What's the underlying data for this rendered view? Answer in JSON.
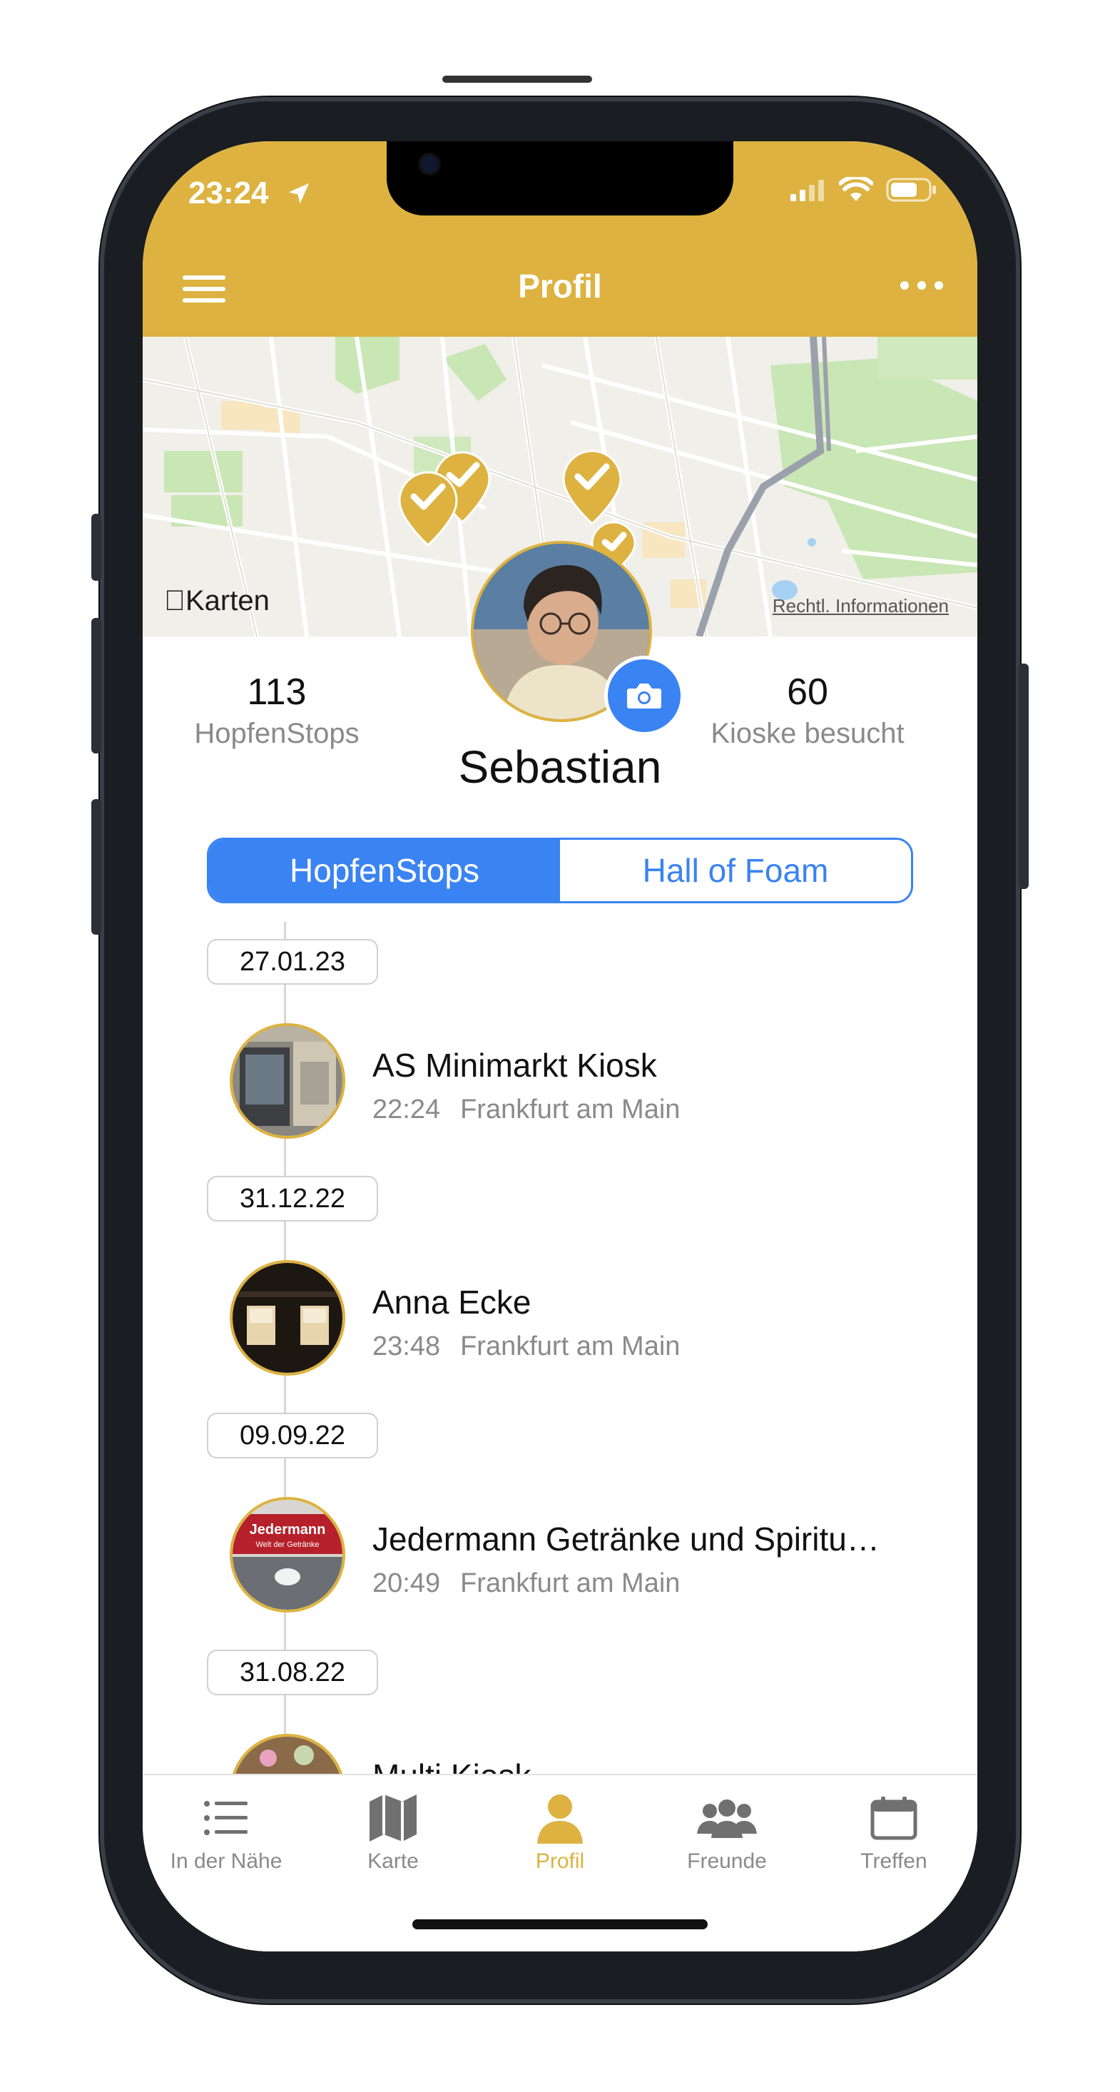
{
  "status_bar": {
    "time": "23:24"
  },
  "header": {
    "title": "Profil"
  },
  "map": {
    "logo_text": "Karten",
    "legal_link": "Rechtl. Informationen"
  },
  "profile": {
    "name": "Sebastian",
    "stats": [
      {
        "value": "113",
        "label": "HopfenStops"
      },
      {
        "value": "60",
        "label": "Kioske besucht"
      }
    ]
  },
  "segmented": {
    "options": [
      "HopfenStops",
      "Hall of Foam"
    ],
    "selected": "HopfenStops"
  },
  "timeline": [
    {
      "date": "27.01.23",
      "name": "AS Minimarkt Kiosk",
      "time": "22:24",
      "city": "Frankfurt am Main"
    },
    {
      "date": "31.12.22",
      "name": "Anna Ecke",
      "time": "23:48",
      "city": "Frankfurt am Main"
    },
    {
      "date": "09.09.22",
      "name": "Jedermann Getränke und Spiritu…",
      "time": "20:49",
      "city": "Frankfurt am Main"
    },
    {
      "date": "31.08.22",
      "name": "Multi Kiosk",
      "time": "",
      "city": ""
    }
  ],
  "thumb_texts": {
    "jedermann_sign": "Jedermann",
    "jedermann_sub": "Welt der Getränke"
  },
  "tabbar": [
    {
      "label": "In der Nähe",
      "icon": "list-icon"
    },
    {
      "label": "Karte",
      "icon": "map-icon"
    },
    {
      "label": "Profil",
      "icon": "person-icon",
      "active": true
    },
    {
      "label": "Freunde",
      "icon": "friends-icon"
    },
    {
      "label": "Treffen",
      "icon": "calendar-icon"
    }
  ],
  "colors": {
    "accent": "#DDB240",
    "blue": "#3A83F2"
  }
}
